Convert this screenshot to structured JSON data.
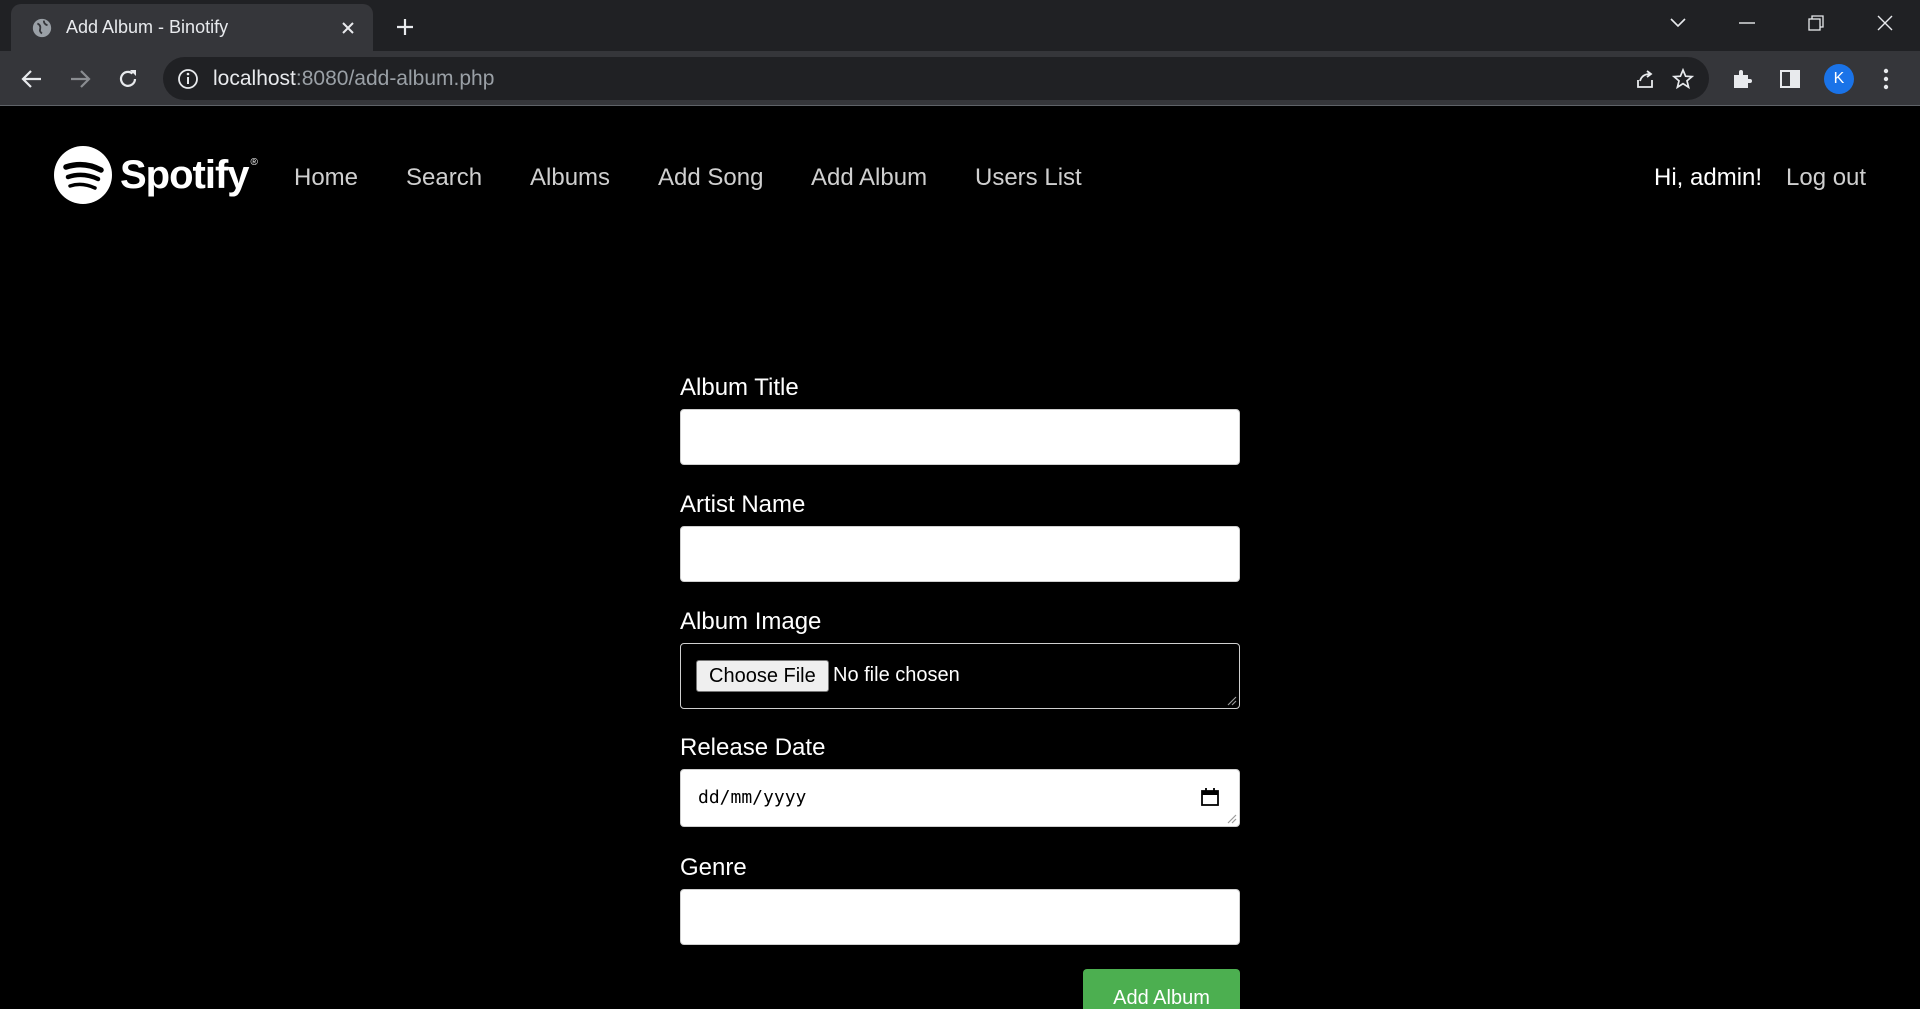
{
  "browser": {
    "tab_title": "Add Album - Binotify",
    "url_host": "localhost",
    "url_rest": ":8080/add-album.php",
    "profile_initial": "K"
  },
  "header": {
    "logo_text": "Spotify",
    "logo_reg": "®",
    "nav": [
      "Home",
      "Search",
      "Albums",
      "Add Song",
      "Add Album",
      "Users List"
    ],
    "greeting": "Hi, admin!",
    "logout": "Log out"
  },
  "form": {
    "album_title_label": "Album Title",
    "artist_name_label": "Artist Name",
    "album_image_label": "Album Image",
    "choose_file_label": "Choose File",
    "file_status": "No file chosen",
    "release_date_label": "Release Date",
    "release_date_placeholder": "dd/mm/yyyy",
    "genre_label": "Genre",
    "submit_label": "Add Album"
  },
  "colors": {
    "accent_green": "#4caf50",
    "page_background": "#000000",
    "profile_blue": "#1a73e8"
  }
}
